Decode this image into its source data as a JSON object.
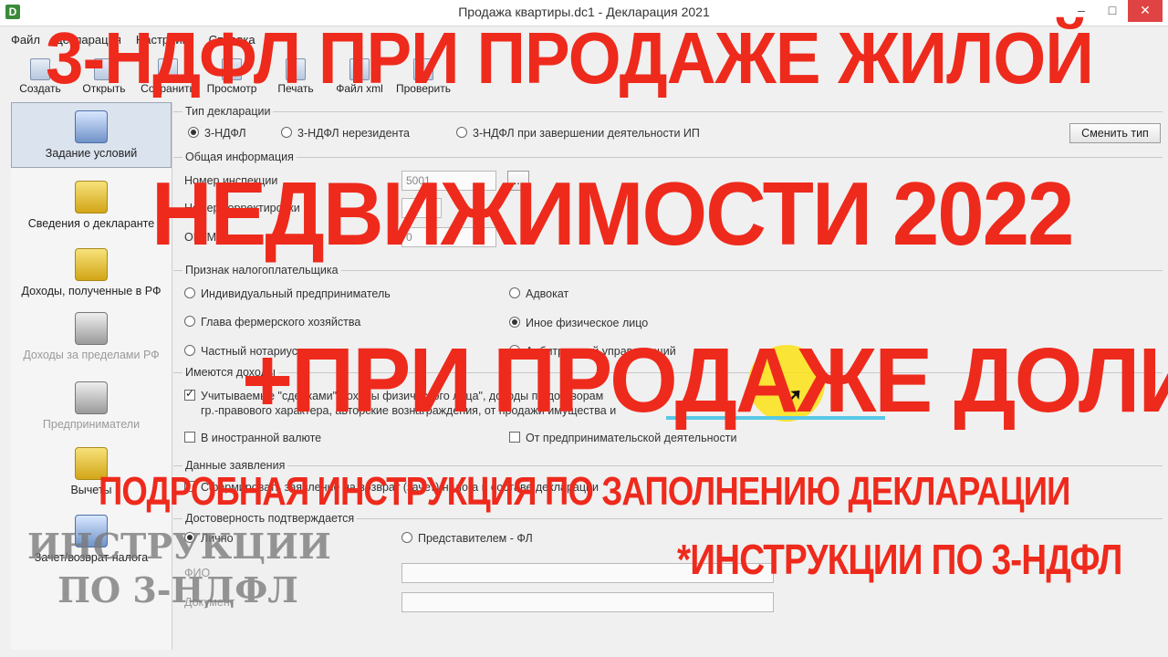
{
  "window": {
    "title": "Продажа квартиры.dc1 - Декларация 2021",
    "app_icon": "D",
    "controls": [
      "–",
      "□",
      "✕"
    ]
  },
  "menu": [
    "Файл",
    "Декларация",
    "Настройки",
    "Справка"
  ],
  "toolbar": [
    {
      "icon": "new-document-icon",
      "label": "Создать"
    },
    {
      "icon": "open-folder-icon",
      "label": "Открыть"
    },
    {
      "icon": "save-icon",
      "label": "Сохранить"
    },
    {
      "icon": "preview-icon",
      "label": "Просмотр"
    },
    {
      "icon": "print-icon",
      "label": "Печать"
    },
    {
      "icon": "xml-file-icon",
      "label": "Файл xml"
    },
    {
      "icon": "check-icon",
      "label": "Проверить"
    }
  ],
  "sidebar": [
    {
      "icon": "conditions-icon",
      "label": "Задание условий",
      "active": true,
      "disabled": false
    },
    {
      "icon": "declarant-icon",
      "label": "Сведения о декларанте",
      "active": false,
      "disabled": false
    },
    {
      "icon": "coins-icon",
      "label": "Доходы, полученные в РФ",
      "active": false,
      "disabled": false
    },
    {
      "icon": "money-bag-icon",
      "label": "Доходы за пределами РФ",
      "active": false,
      "disabled": true
    },
    {
      "icon": "entrepreneur-icon",
      "label": "Предприниматели",
      "active": false,
      "disabled": true
    },
    {
      "icon": "deductions-icon",
      "label": "Вычеты",
      "active": false,
      "disabled": false
    },
    {
      "icon": "tax-return-icon",
      "label": "Зачет/возврат налога",
      "active": false,
      "disabled": false
    }
  ],
  "decl_type": {
    "legend": "Тип декларации",
    "options": [
      "3-НДФЛ",
      "3-НДФЛ нерезидента",
      "3-НДФЛ при завершении деятельности ИП"
    ],
    "selected": 0,
    "change_button": "Сменить тип"
  },
  "general": {
    "legend": "Общая информация",
    "inspection_label": "Номер инспекции",
    "inspection_value": "5001",
    "browse_button": "...",
    "correction_label": "Номер корректировки",
    "oktmo_label": "ОКТМО",
    "oktmo_value": "0"
  },
  "taxpayer": {
    "legend": "Признак налогоплательщика",
    "options": [
      "Индивидуальный предприниматель",
      "Адвокат",
      "Глава фермерского хозяйства",
      "Иное физическое лицо",
      "Частный нотариус",
      "Арбитражный управляющий"
    ],
    "selected": 3
  },
  "income": {
    "legend": "Имеются доходы",
    "line1": "Учитываемые \"сделками\" доходы физического лица\", доходы по договорам",
    "line2": "гр.-правового характера, авторские вознаграждения, от продажи имущества и",
    "foreign_currency": "В иностранной валюте",
    "business": "От предпринимательской деятельности"
  },
  "statement": {
    "legend": "Данные заявления",
    "text": "Сформировать заявление на возврат (зачет) налога в составе декларации"
  },
  "confirm": {
    "legend": "Достоверность подтверждается",
    "personally": "Лично",
    "representative": "Представителем - ФЛ",
    "fio_label": "ФИО",
    "document_label": "Документ"
  },
  "overlay": {
    "line1": "3-НДФЛ ПРИ ПРОДАЖЕ ЖИЛОЙ",
    "line2": "НЕДВИЖИМОСТИ  2022",
    "line3": "+ПРИ ПРОДАЖЕ ДОЛИ",
    "line4": "ПОДРОБНАЯ ИНСТРУКЦИЯ ПО ЗАПОЛНЕНИЮ ДЕКЛАРАЦИИ",
    "line5": "*ИНСТРУКЦИИ ПО 3-НДФЛ",
    "color": "#ee2a1c"
  },
  "watermark": {
    "line1": "ИНСТРУКЦИИ",
    "line2": "ПО 3-НДФЛ"
  }
}
